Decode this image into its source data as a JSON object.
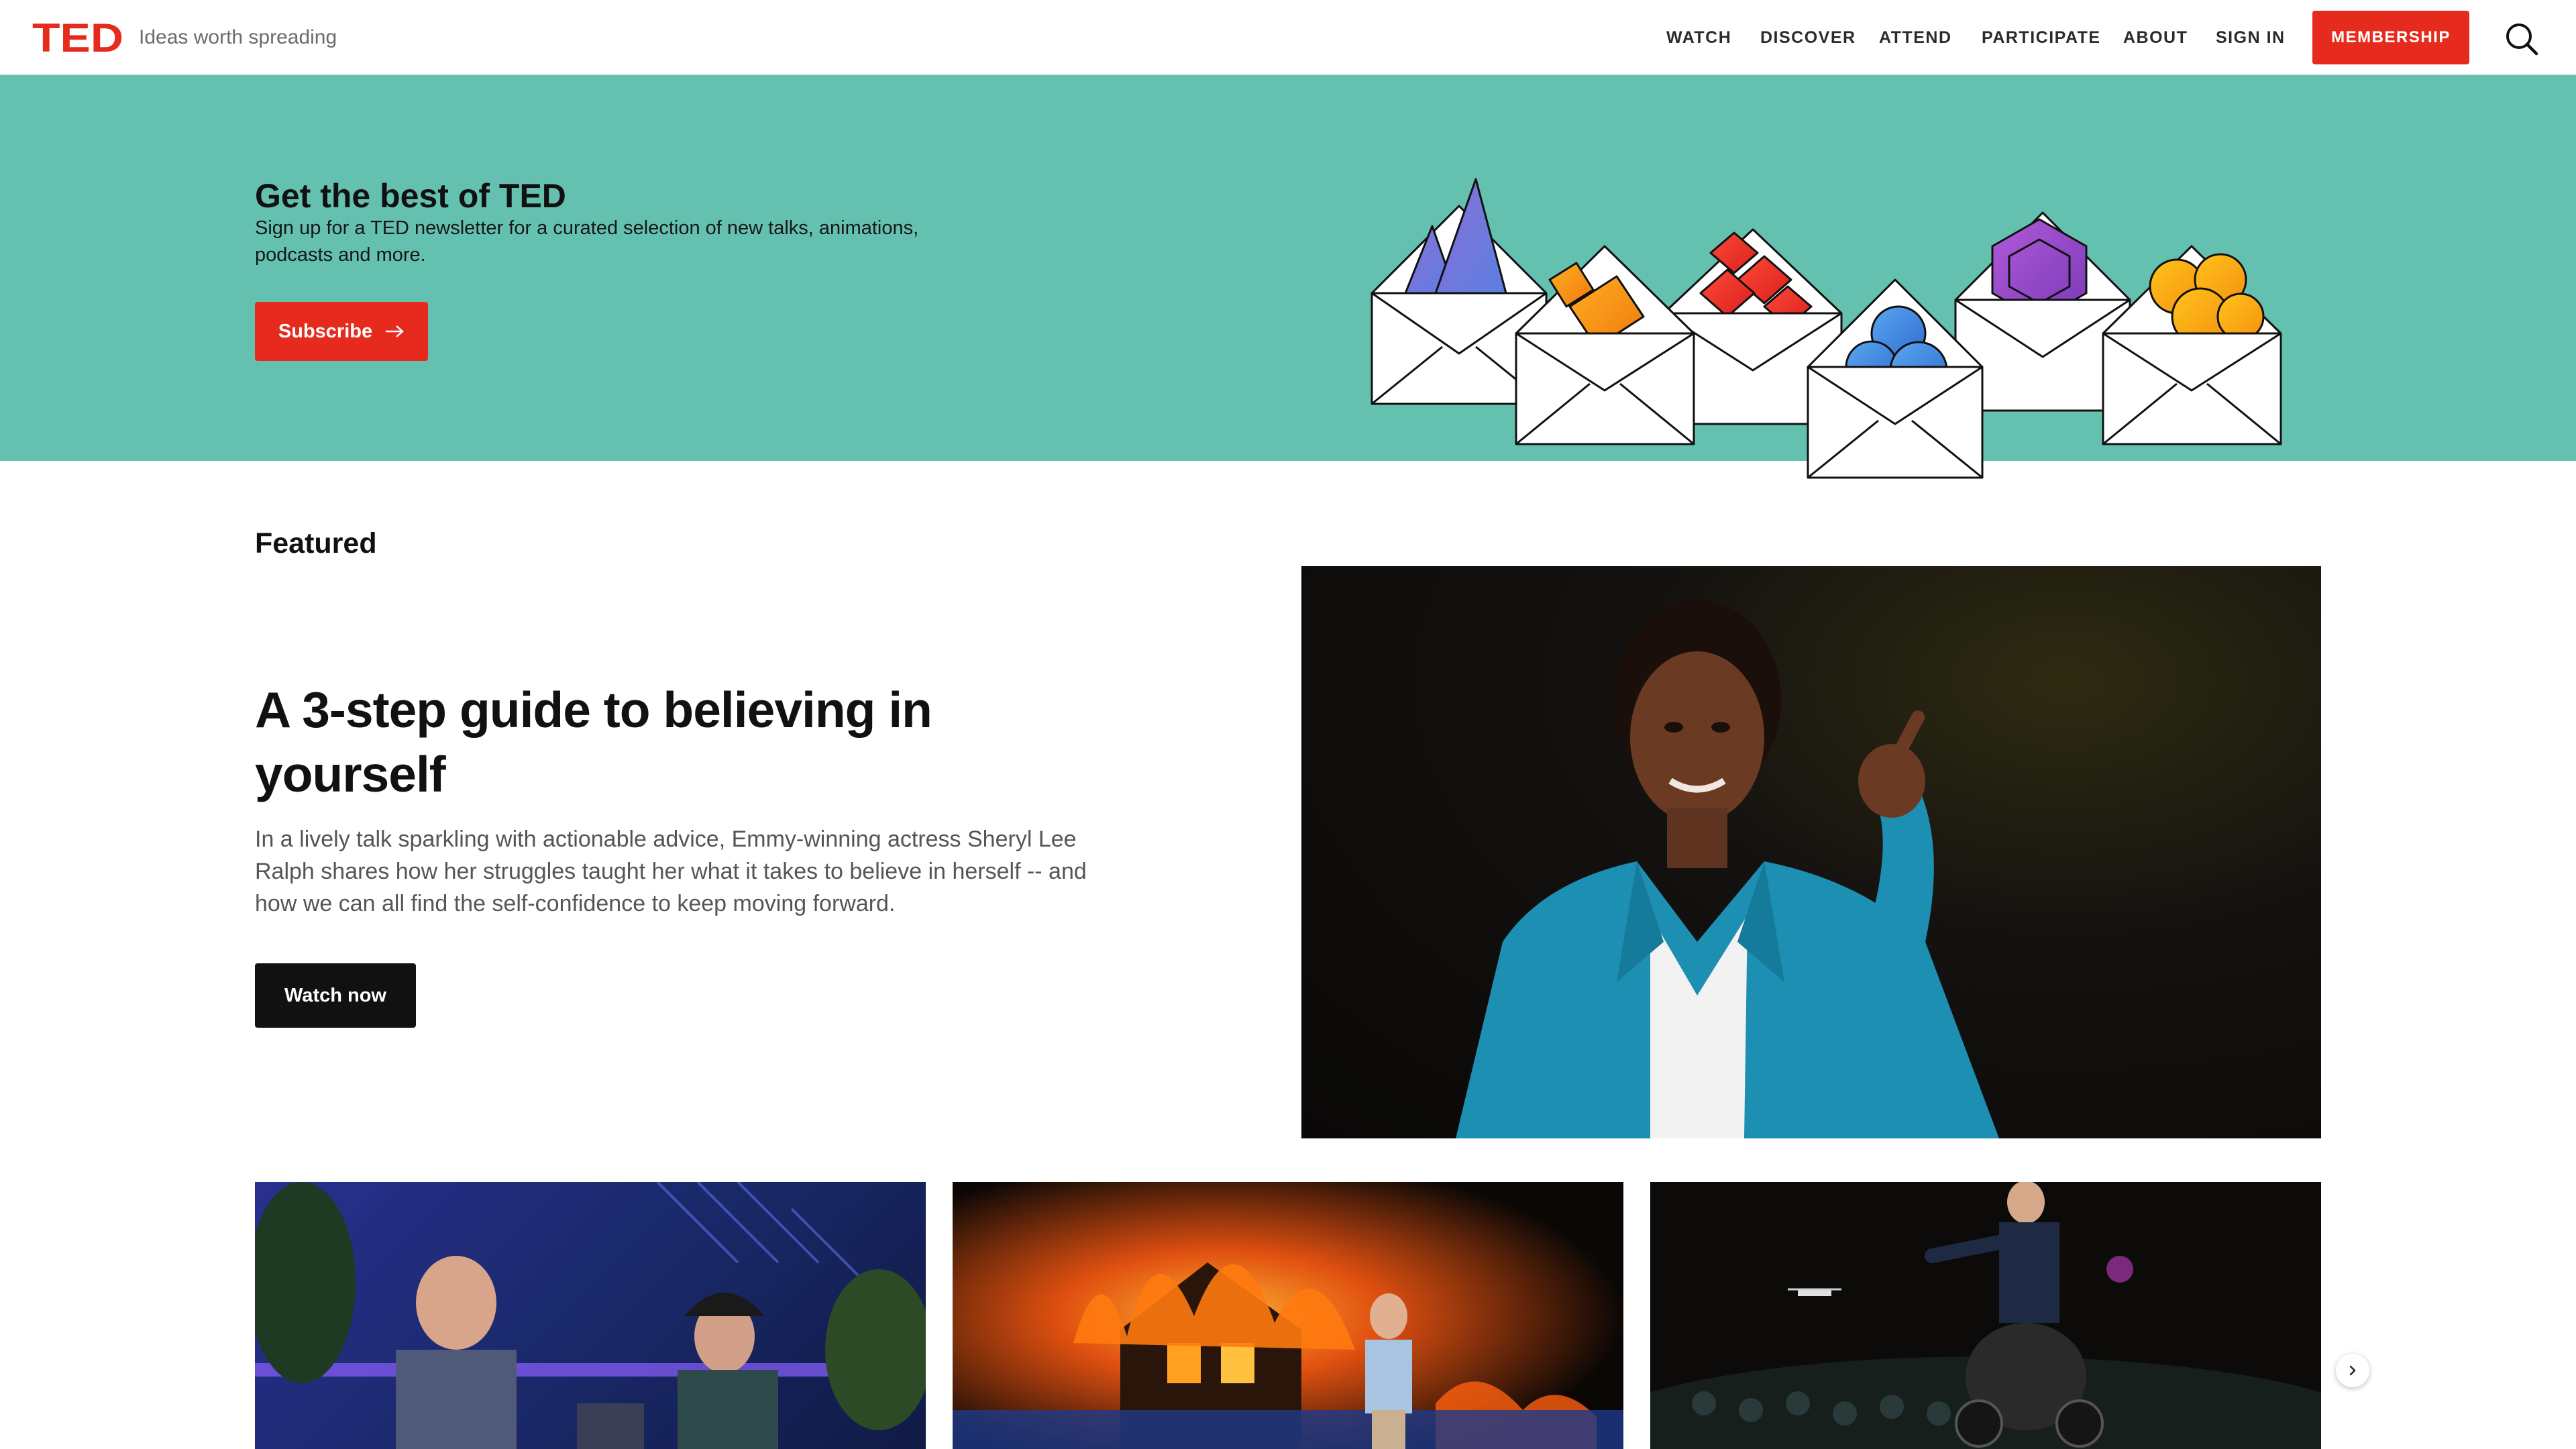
{
  "header": {
    "logo_text": "TED",
    "tagline": "Ideas worth spreading",
    "nav": [
      {
        "label": "WATCH"
      },
      {
        "label": "DISCOVER"
      },
      {
        "label": "ATTEND"
      },
      {
        "label": "PARTICIPATE"
      },
      {
        "label": "ABOUT"
      },
      {
        "label": "SIGN IN"
      }
    ],
    "membership_label": "MEMBERSHIP",
    "search_icon": "search-icon"
  },
  "banner": {
    "title": "Get the best of TED",
    "description": "Sign up for a TED newsletter for a curated selection of new talks, animations, podcasts and more.",
    "subscribe_label": "Subscribe",
    "background_color": "#64c1b0",
    "button_color": "#e62b1e"
  },
  "featured": {
    "heading": "Featured",
    "title": "A 3-step guide to believing in yourself",
    "description": "In a lively talk sparkling with actionable advice, Emmy-winning actress Sheryl Lee Ralph shares how her struggles taught her what it takes to believe in herself -- and how we can all find the self-confidence to keep moving forward.",
    "watch_label": "Watch now"
  },
  "carousel": {
    "cards": [
      {
        "scene": "interview-stage-photo"
      },
      {
        "scene": "burning-house-speaker-photo"
      },
      {
        "scene": "drone-stage-speaker-photo"
      }
    ],
    "next_icon": "chevron-right-icon"
  },
  "colors": {
    "brand_red": "#e62b1e",
    "dark_button": "#111111"
  }
}
